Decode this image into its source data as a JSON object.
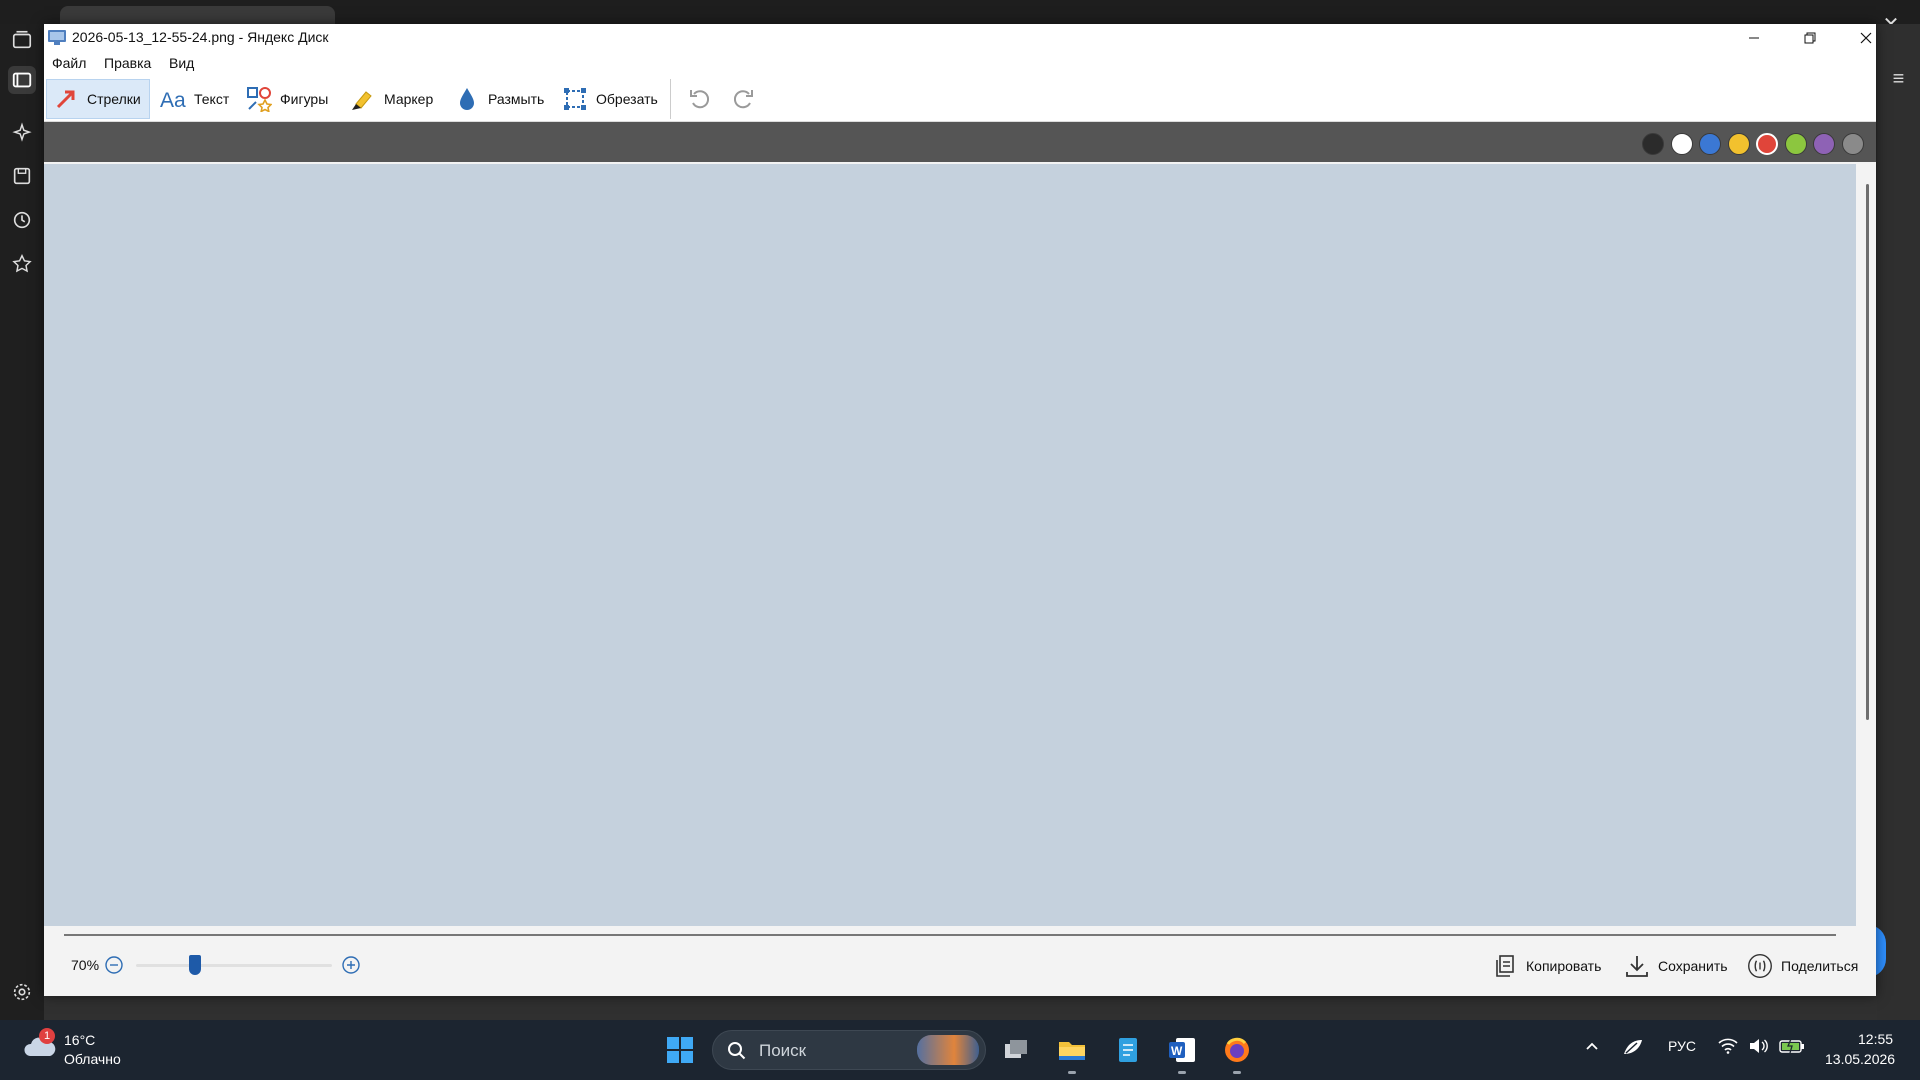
{
  "window": {
    "title": "2026-05-13_12-55-24.png - Яндекс Диск"
  },
  "menu": [
    "Файл",
    "Правка",
    "Вид"
  ],
  "toolbar": {
    "tools": [
      "Стрелки",
      "Текст",
      "Фигуры",
      "Маркер",
      "Размыть",
      "Обрезать"
    ],
    "active_tool": "Стрелки"
  },
  "colors": {
    "palette": [
      "#2b2b2b",
      "#ffffff",
      "#3b78d4",
      "#f2c12e",
      "#e0453a",
      "#8cc63f",
      "#8e62b5",
      "#8a8a8a"
    ],
    "selected": "#e0453a",
    "canvas_bg": "#c5d1dd",
    "accent": "#1e5aa8"
  },
  "status": {
    "zoom": "70%",
    "zoom_fraction": 0.3,
    "copy_label": "Копировать",
    "save_label": "Сохранить",
    "share_label": "Поделиться"
  },
  "taskbar": {
    "weather_badge": "1",
    "temperature": "16°C",
    "condition": "Облачно",
    "search_placeholder": "Поиск",
    "language": "РУС",
    "time": "12:55",
    "date": "13.05.2026"
  }
}
